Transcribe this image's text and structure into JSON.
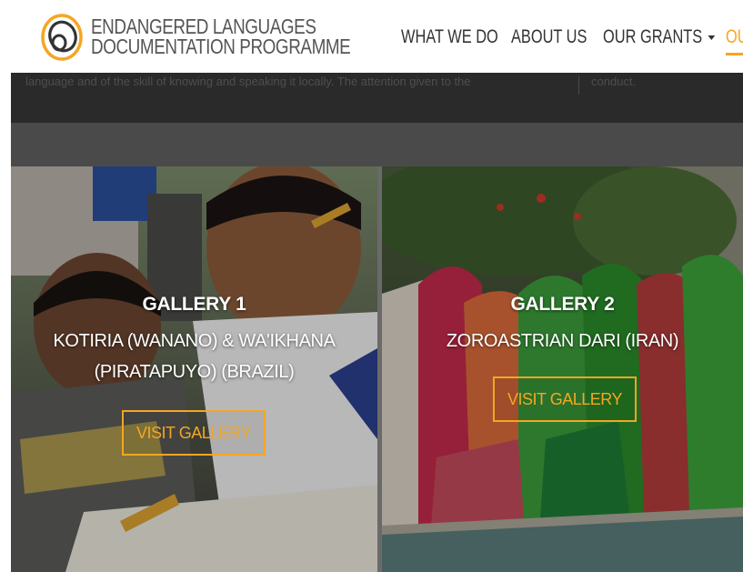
{
  "header": {
    "brand_line1": "ENDANGERED LANGUAGES",
    "brand_line2": "DOCUMENTATION PROGRAMME",
    "nav": [
      {
        "label": "WHAT WE DO"
      },
      {
        "label": "ABOUT US"
      },
      {
        "label": "OUR GRANTS"
      },
      {
        "label": "OU"
      }
    ]
  },
  "strip": {
    "left_text": "language and of the skill of knowing and speaking it locally. The attention given to the",
    "right_text": "conduct."
  },
  "galleries": [
    {
      "title": "GALLERY 1",
      "subtitle_line1": "KOTIRIA (WANANO) & WA'IKHANA",
      "subtitle_line2": "(PIRATAPUYO) (BRAZIL)",
      "button": "VISIT GALLERY"
    },
    {
      "title": "GALLERY 2",
      "subtitle_line1": "ZOROASTRIAN DARI (IRAN)",
      "button": "VISIT GALLERY"
    }
  ],
  "colors": {
    "accent": "#f5a623",
    "nav_text": "#333333",
    "brand_text": "#555555",
    "dark_strip": "#2a2a2a"
  }
}
